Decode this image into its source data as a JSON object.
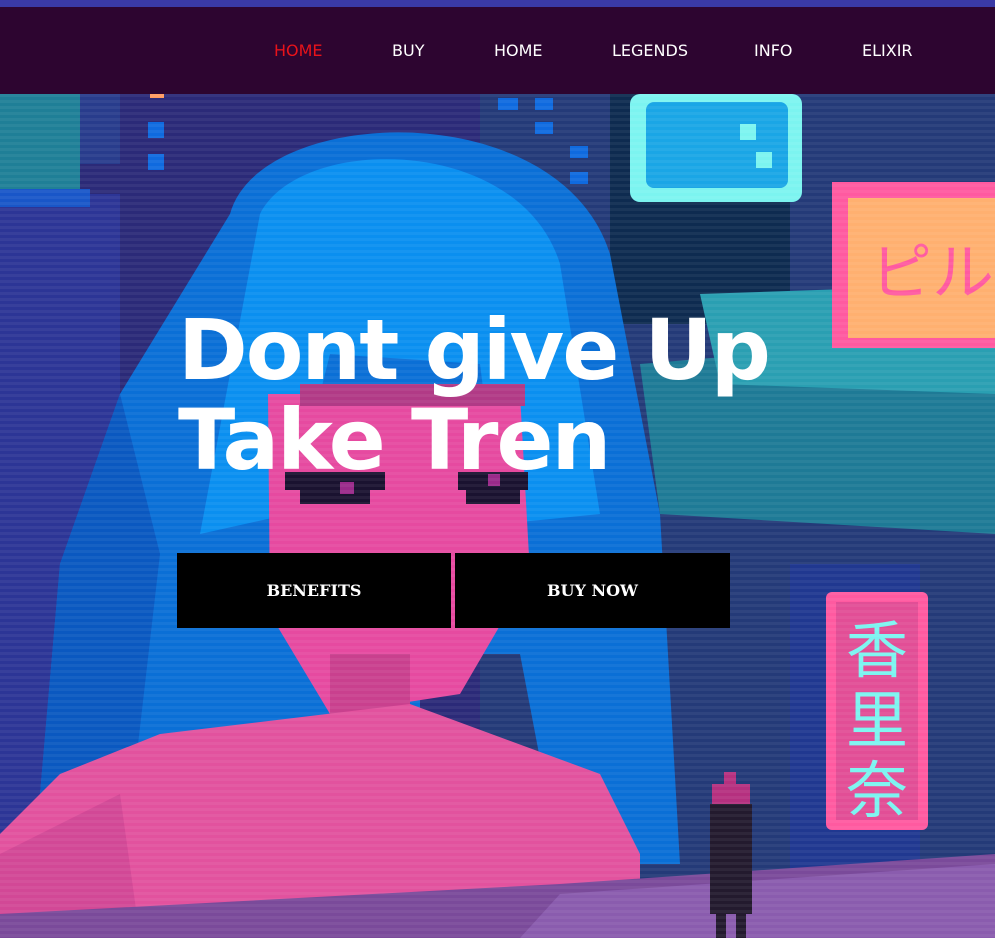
{
  "nav": {
    "items": [
      {
        "label": "HOME",
        "active": true
      },
      {
        "label": "BUY",
        "active": false
      },
      {
        "label": "HOME",
        "active": false
      },
      {
        "label": "LEGENDS",
        "active": false
      },
      {
        "label": "INFO",
        "active": false
      },
      {
        "label": "ELIXIR",
        "active": false
      }
    ],
    "active_color": "#e8131a",
    "background": "#2d0530"
  },
  "hero": {
    "headline_line1": "Dont give Up",
    "headline_line2": "Take Tren",
    "background_art": "pixel-art-cyberpunk-girl-city",
    "buttons": {
      "benefits_label": "BENEFITS",
      "buy_now_label": "BUY NOW"
    },
    "sign_glyphs": [
      "香",
      "里",
      "奈"
    ],
    "sign_top_glyphs": "ピル"
  },
  "colors": {
    "hair_blue": "#0a7be0",
    "skin_pink": "#e64aa0",
    "city_navy": "#1e2a6e",
    "teal": "#1e8aa0",
    "neon_cyan": "#7cf4f0",
    "sign_pink": "#ff5aa0",
    "sign_orange": "#ffb070"
  }
}
